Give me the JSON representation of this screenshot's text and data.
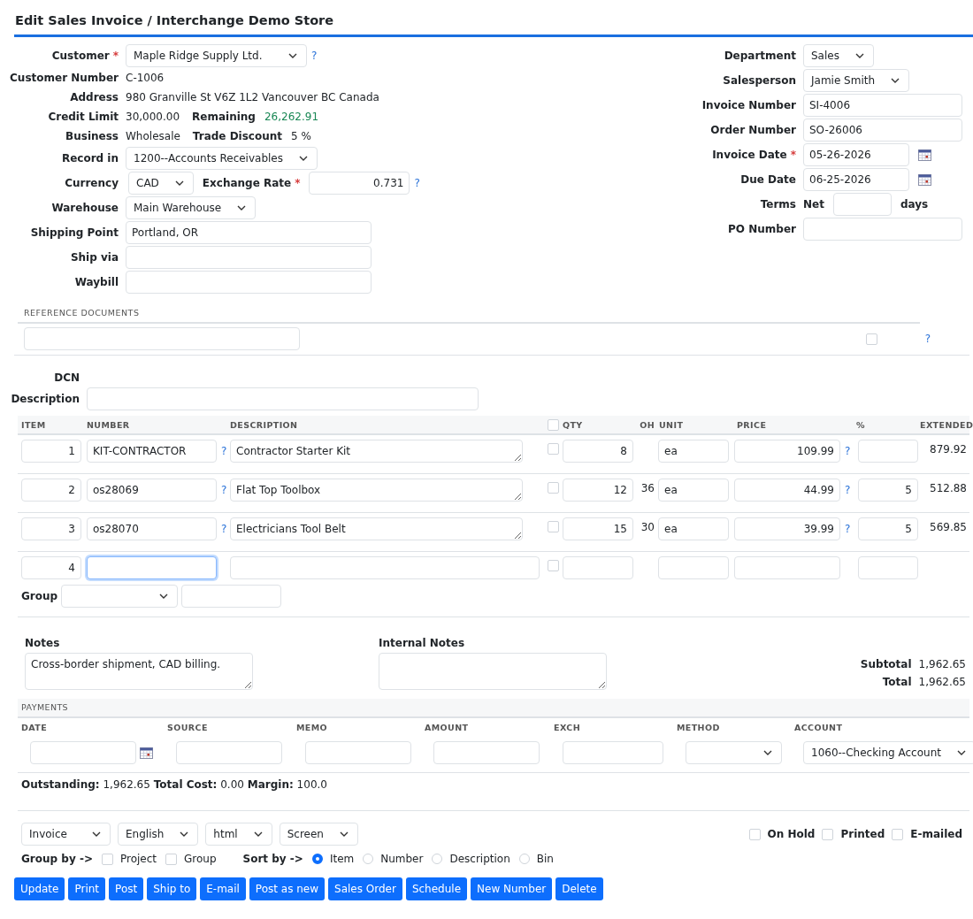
{
  "title": "Edit Sales Invoice / Interchange Demo Store",
  "left_fields": [
    {
      "kind": "select",
      "label": "Customer",
      "required_mark": "*",
      "value": "Maple Ridge Supply Ltd.",
      "help": "?"
    },
    {
      "kind": "text",
      "label": "Customer Number",
      "value": "C-1006"
    },
    {
      "kind": "text",
      "label": "Address",
      "value": "980 Granville St V6Z 1L2 Vancouver BC Canada"
    },
    {
      "kind": "pair",
      "label": "Credit Limit",
      "value": "30,000.00",
      "label2": "Remaining",
      "value2": "26,262.91",
      "positive": true
    },
    {
      "kind": "pair",
      "label": "Business",
      "value": "Wholesale",
      "label2": "Trade Discount",
      "value2": "5 %",
      "positive": false
    },
    {
      "kind": "select",
      "label": "Record in",
      "value": "1200--Accounts Receivables"
    },
    {
      "kind": "currency",
      "label": "Currency",
      "value": "CAD",
      "label2": "Exchange Rate",
      "required_mark": "*",
      "value2": "0.731",
      "help": "?"
    },
    {
      "kind": "select",
      "label": "Warehouse",
      "value": "Main Warehouse"
    },
    {
      "kind": "input",
      "label": "Shipping Point",
      "value": "Portland, OR"
    },
    {
      "kind": "input",
      "label": "Ship via"
    },
    {
      "kind": "input",
      "label": "Waybill"
    }
  ],
  "right_fields": [
    {
      "kind": "select",
      "label": "Department",
      "value": "Sales"
    },
    {
      "kind": "select",
      "label": "Salesperson",
      "value": "Jamie Smith"
    },
    {
      "kind": "input",
      "label": "Invoice Number",
      "value": "SI-4006"
    },
    {
      "kind": "input",
      "label": "Order Number",
      "value": "SO-26006"
    },
    {
      "kind": "date",
      "label": "Invoice Date",
      "required_mark": "*",
      "value": "05-26-2026"
    },
    {
      "kind": "date",
      "label": "Due Date",
      "value": "06-25-2026"
    },
    {
      "kind": "terms",
      "label": "Terms",
      "prefix": "Net",
      "suffix": "days"
    },
    {
      "kind": "input",
      "label": "PO Number"
    }
  ],
  "reference": {
    "heading": "REFERENCE DOCUMENTS",
    "checked": false,
    "help": "?"
  },
  "dcn": {
    "label": "DCN"
  },
  "description": {
    "label": "Description"
  },
  "lines": {
    "columns": [
      {
        "kind": "text",
        "label": "ITEM"
      },
      {
        "kind": "text",
        "label": "NUMBER"
      },
      {
        "kind": "text",
        "label": "DESCRIPTION"
      },
      {
        "kind": "checkbox",
        "checked": false
      },
      {
        "kind": "text",
        "label": "QTY"
      },
      {
        "kind": "text",
        "label": "OH"
      },
      {
        "kind": "text",
        "label": "UNIT"
      },
      {
        "kind": "text",
        "label": "PRICE"
      },
      {
        "kind": "text",
        "label": "%"
      },
      {
        "kind": "text",
        "label": "EXTENDED"
      }
    ],
    "rows": [
      {
        "kind": "line",
        "item": "1",
        "number": "KIT-CONTRACTOR",
        "help": "?",
        "description": "Contractor Starter Kit",
        "checked": false,
        "qty": "8",
        "unit": "ea",
        "price": "109.99",
        "price_help": "?",
        "extended": "879.92",
        "focused": false
      },
      {
        "kind": "line",
        "item": "2",
        "number": "os28069",
        "help": "?",
        "description": "Flat Top Toolbox",
        "checked": false,
        "qty": "12",
        "oh": "36",
        "unit": "ea",
        "price": "44.99",
        "price_help": "?",
        "discount": "5",
        "extended": "512.88",
        "focused": false
      },
      {
        "kind": "line",
        "item": "3",
        "number": "os28070",
        "help": "?",
        "description": "Electricians Tool Belt",
        "checked": false,
        "qty": "15",
        "oh": "30",
        "unit": "ea",
        "price": "39.99",
        "price_help": "?",
        "discount": "5",
        "extended": "569.85",
        "focused": false
      },
      {
        "kind": "new",
        "item": "4",
        "checked": false,
        "focused": true
      }
    ]
  },
  "group": {
    "label": "Group"
  },
  "notes": [
    {
      "label": "Notes",
      "value": "Cross-border shipment, CAD billing."
    },
    {
      "label": "Internal Notes"
    }
  ],
  "totals": [
    {
      "label": "Subtotal",
      "value": "1,962.65"
    },
    {
      "label": "Total",
      "value": "1,962.65"
    }
  ],
  "payments": {
    "heading": "PAYMENTS",
    "columns": [
      "DATE",
      "SOURCE",
      "MEMO",
      "AMOUNT",
      "EXCH",
      "METHOD",
      "ACCOUNT"
    ],
    "account": "1060--Checking Account"
  },
  "summary": "**Outstanding:** 1,962.65 **Total Cost:** 0.00 **Margin:** 100.0",
  "output": {
    "selects": [
      "Invoice",
      "English",
      "html",
      "Screen"
    ],
    "flags": [
      {
        "label": "On Hold",
        "checked": false
      },
      {
        "label": "Printed",
        "checked": false
      },
      {
        "label": "E-mailed",
        "checked": false
      }
    ]
  },
  "group_by": {
    "label": "Group by ->",
    "options": [
      {
        "label": "Project",
        "checked": false
      },
      {
        "label": "Group",
        "checked": false
      }
    ]
  },
  "sort_by": {
    "label": "Sort by ->",
    "options": [
      {
        "label": "Item",
        "selected": true
      },
      {
        "label": "Number",
        "selected": false
      },
      {
        "label": "Description",
        "selected": false
      },
      {
        "label": "Bin",
        "selected": false
      }
    ]
  },
  "buttons": [
    "Update",
    "Print",
    "Post",
    "Ship to",
    "E-mail",
    "Post as new",
    "Sales Order",
    "Schedule",
    "New Number",
    "Delete"
  ]
}
